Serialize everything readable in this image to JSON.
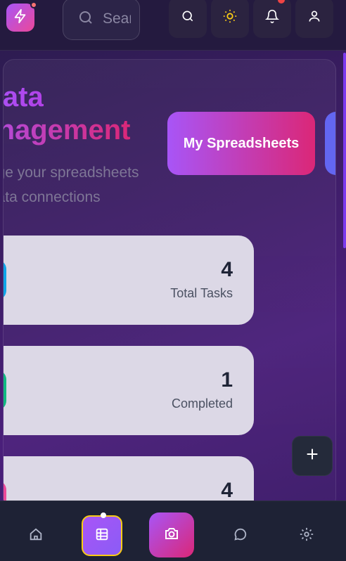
{
  "topbar": {
    "search_placeholder": "Search",
    "icons": [
      "lightning-icon",
      "search-icon",
      "sun-icon",
      "bell-icon",
      "user-icon"
    ]
  },
  "header": {
    "title_line1": "Data",
    "title_line2": "Management",
    "subtitle_line1": "Manage your spreadsheets",
    "subtitle_line2": "and data connections"
  },
  "actions": {
    "my_spreadsheets": "My Spreadsheets"
  },
  "stats": [
    {
      "value": "4",
      "label": "Total Tasks",
      "color": "#0ea5e9",
      "icon": "table-icon"
    },
    {
      "value": "1",
      "label": "Completed",
      "color": "#10b981",
      "icon": "trend-up-icon"
    },
    {
      "value": "4",
      "label": "",
      "color": "#ec4899",
      "icon": "refresh-icon"
    }
  ],
  "bottom_nav": {
    "items": [
      "home-icon",
      "spreadsheet-icon",
      "camera-icon",
      "chat-icon",
      "settings-icon"
    ],
    "active": "spreadsheet-icon"
  },
  "colors": {
    "accent_purple": "#a855f7",
    "accent_pink": "#db2777",
    "active_outline": "#facc15"
  }
}
